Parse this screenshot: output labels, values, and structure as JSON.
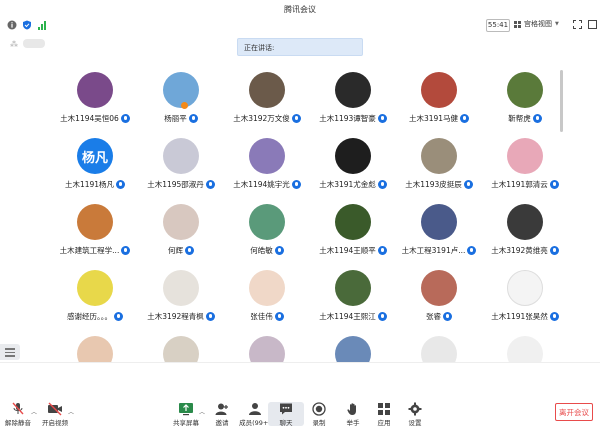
{
  "window": {
    "title": "腾讯会议"
  },
  "toolbar": {
    "timer": "55:41",
    "view_mode": "宫格视图"
  },
  "speaking_banner": {
    "label": "正在讲话:"
  },
  "self_preview": {
    "name": ""
  },
  "participants": [
    {
      "name": "土木1194吴恒06",
      "color": "#7a4a8a"
    },
    {
      "name": "杨丽平",
      "color": "#6fa7d8",
      "badge_color": "#f28a1a"
    },
    {
      "name": "土木3192万文俊",
      "color": "#6b5a4a"
    },
    {
      "name": "土木1193谭智豪",
      "color": "#2a2a2a"
    },
    {
      "name": "土木3191马健",
      "color": "#b34a3c"
    },
    {
      "name": "靳帮虎",
      "color": "#5a7a3a"
    },
    {
      "name": "土木1191杨凡",
      "avatar_text": "杨凡",
      "color": "#1a7de8"
    },
    {
      "name": "土木1195邵淑丹",
      "color": "#c9c9d6"
    },
    {
      "name": "土木1194姚宇光",
      "color": "#8a7ab8"
    },
    {
      "name": "土木3191尤金彪",
      "color": "#1e1e1e"
    },
    {
      "name": "土木1193皮挺辰",
      "color": "#9a8e7a"
    },
    {
      "name": "土木1191郭清云",
      "color": "#e8a8b8"
    },
    {
      "name": "土木建筑工程学...",
      "color": "#c97a3a"
    },
    {
      "name": "何辉",
      "color": "#d8c8c0"
    },
    {
      "name": "何皓敏",
      "color": "#5a9a7a"
    },
    {
      "name": "土木1194王顺平",
      "color": "#3a5a2a"
    },
    {
      "name": "土木工程3191卢...",
      "color": "#4a5a8a"
    },
    {
      "name": "土木3192黄维亮",
      "color": "#3a3a3a"
    },
    {
      "name": "感谢经历。。。",
      "color": "#e8d84a"
    },
    {
      "name": "土木3192程青枫",
      "color": "#e6e2dc"
    },
    {
      "name": "张佳伟",
      "color": "#f0d8c8"
    },
    {
      "name": "土木1194王熙江",
      "color": "#4a6a3a"
    },
    {
      "name": "张睿",
      "color": "#b86a5a"
    },
    {
      "name": "土木1191张昊然",
      "color": "#f4f4f4"
    },
    {
      "name": "",
      "color": "#e8c8b0"
    },
    {
      "name": "",
      "color": "#d8d0c4"
    },
    {
      "name": "",
      "color": "#c8b8c8"
    },
    {
      "name": "",
      "color": "#6a8ab8"
    },
    {
      "name": "",
      "color": "#e8e8e8"
    },
    {
      "name": "",
      "color": "#f0f0f0"
    }
  ],
  "bottom_bar": {
    "unmute": "解除静音",
    "start_video": "开启视频",
    "share_screen": "共享屏幕",
    "invite": "邀请",
    "members": "成员(99+)",
    "chat": "聊天",
    "record": "录制",
    "raise_hand": "举手",
    "apps": "应用",
    "settings": "设置",
    "leave": "离开会议"
  },
  "colors": {
    "accent": "#1a6fe0",
    "danger": "#e84b4b",
    "speaking_bg": "#dde9f8",
    "share_green": "#2a8a4a"
  },
  "icons": [
    "info-icon",
    "shield-icon",
    "signal-icon",
    "grid-view-icon",
    "fullscreen-icon",
    "mic-icon",
    "microphone-muted-icon",
    "video-off-icon",
    "share-screen-icon",
    "invite-icon",
    "members-icon",
    "chat-icon",
    "record-icon",
    "raise-hand-icon",
    "apps-icon",
    "settings-icon"
  ]
}
